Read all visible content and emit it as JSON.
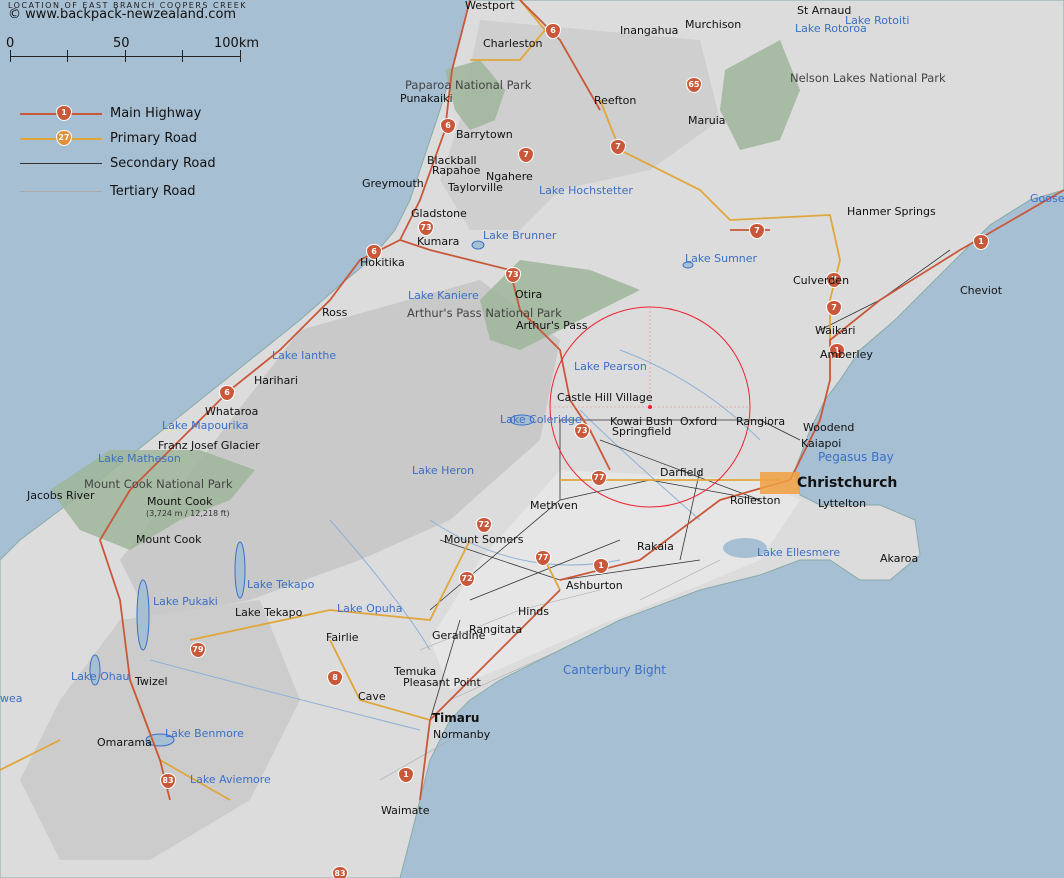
{
  "header": {
    "title": "Location of East Branch Coopers Creek",
    "site": "© www.backpack-newzealand.com"
  },
  "scale": {
    "labels": [
      "0",
      "50",
      "100km"
    ]
  },
  "legend": [
    {
      "label": "Main Highway",
      "color": "#c9583a",
      "shield": "1"
    },
    {
      "label": "Primary Road",
      "color": "#e0a63a",
      "shield": "27"
    },
    {
      "label": "Secondary Road",
      "color": "#333333",
      "shield": ""
    },
    {
      "label": "Tertiary Road",
      "color": "#aaaaaa",
      "shield": ""
    }
  ],
  "colors": {
    "sea": "#a7bfd3",
    "land": "#dcdcdc",
    "park": "#9fb59a",
    "lake": "#3b6fc6",
    "highway": "#c9583a",
    "primary": "#e0a63a",
    "city": "#f0a040"
  },
  "places": {
    "westport": "Westport",
    "st_arnaud": "St Arnaud",
    "lake_rotoiti": "Lake Rotoiti",
    "lake_rotoroa": "Lake Rotoroa",
    "charleston": "Charleston",
    "inangahua": "Inangahua",
    "murchison": "Murchison",
    "paparoa": "Paparoa National Park",
    "nelson_lakes": "Nelson Lakes National Park",
    "punakaiki": "Punakaiki",
    "reefton": "Reefton",
    "maruia": "Maruia",
    "barrytown": "Barrytown",
    "blackball": "Blackball",
    "rapahoe": "Rapahoe",
    "ngahere": "Ngahere",
    "greymouth": "Greymouth",
    "taylorville": "Taylorville",
    "lake_hochstetter": "Lake Hochstetter",
    "goose": "Goose",
    "gladstone": "Gladstone",
    "hanmer": "Hanmer Springs",
    "kumara": "Kumara",
    "lake_brunner": "Lake Brunner",
    "lake_sumner": "Lake Sumner",
    "hokitika": "Hokitika",
    "culverden": "Culverden",
    "cheviot": "Cheviot",
    "otira": "Otira",
    "lake_kaniere": "Lake Kaniere",
    "arthurs_np": "Arthur's Pass National Park",
    "ross": "Ross",
    "arthurs_pass": "Arthur's Pass",
    "waikari": "Waikari",
    "lake_ianthe": "Lake Ianthe",
    "lake_pearson": "Lake Pearson",
    "amberley": "Amberley",
    "harihari": "Harihari",
    "castle_hill": "Castle Hill Village",
    "whataroa": "Whataroa",
    "lake_mapourika": "Lake Mapourika",
    "lake_coleridge": "Lake Coleridge",
    "kowai_bush": "Kowai Bush",
    "oxford": "Oxford",
    "rangiora": "Rangiora",
    "woodend": "Woodend",
    "springfield": "Springfield",
    "franz_josef": "Franz Josef Glacier",
    "kaiapoi": "Kaiapoi",
    "lake_matheson": "Lake Matheson",
    "pegasus_bay": "Pegasus Bay",
    "lake_heron": "Lake Heron",
    "darfield": "Darfield",
    "mt_cook_np": "Mount Cook National Park",
    "christchurch": "Christchurch",
    "jacobs_river": "Jacobs River",
    "mount_cook_peak": "Mount Cook",
    "mount_cook_alt": "(3,724 m / 12,218 ft)",
    "rolleston": "Rolleston",
    "lyttelton": "Lyttelton",
    "methven": "Methven",
    "mount_cook_vil": "Mount Cook",
    "mount_somers": "Mount Somers",
    "rakaia": "Rakaia",
    "lake_ellesmere": "Lake Ellesmere",
    "akaroa": "Akaroa",
    "lake_tekapo_l": "Lake Tekapo",
    "ashburton": "Ashburton",
    "lake_pukaki": "Lake Pukaki",
    "lake_tekapo_t": "Lake Tekapo",
    "lake_opuha": "Lake Opuha",
    "hinds": "Hinds",
    "fairlie": "Fairlie",
    "geraldine": "Geraldine",
    "rangitata": "Rangitata",
    "canterbury_bight": "Canterbury Bight",
    "temuka": "Temuka",
    "lake_ohau": "Lake Ohau",
    "twizel": "Twizel",
    "pleasant_point": "Pleasant Point",
    "wea": "wea",
    "cave": "Cave",
    "timaru": "Timaru",
    "omarama": "Omarama",
    "lake_benmore": "Lake Benmore",
    "normanby": "Normanby",
    "lake_aviemore": "Lake Aviemore",
    "waimate": "Waimate"
  },
  "routes": [
    "6",
    "6",
    "65",
    "6",
    "7",
    "7",
    "7",
    "73",
    "73",
    "7",
    "7",
    "1",
    "1",
    "7",
    "1",
    "6",
    "6",
    "73",
    "77",
    "72",
    "77",
    "72",
    "1",
    "79",
    "8",
    "8",
    "8",
    "1",
    "83",
    "1",
    "83"
  ]
}
